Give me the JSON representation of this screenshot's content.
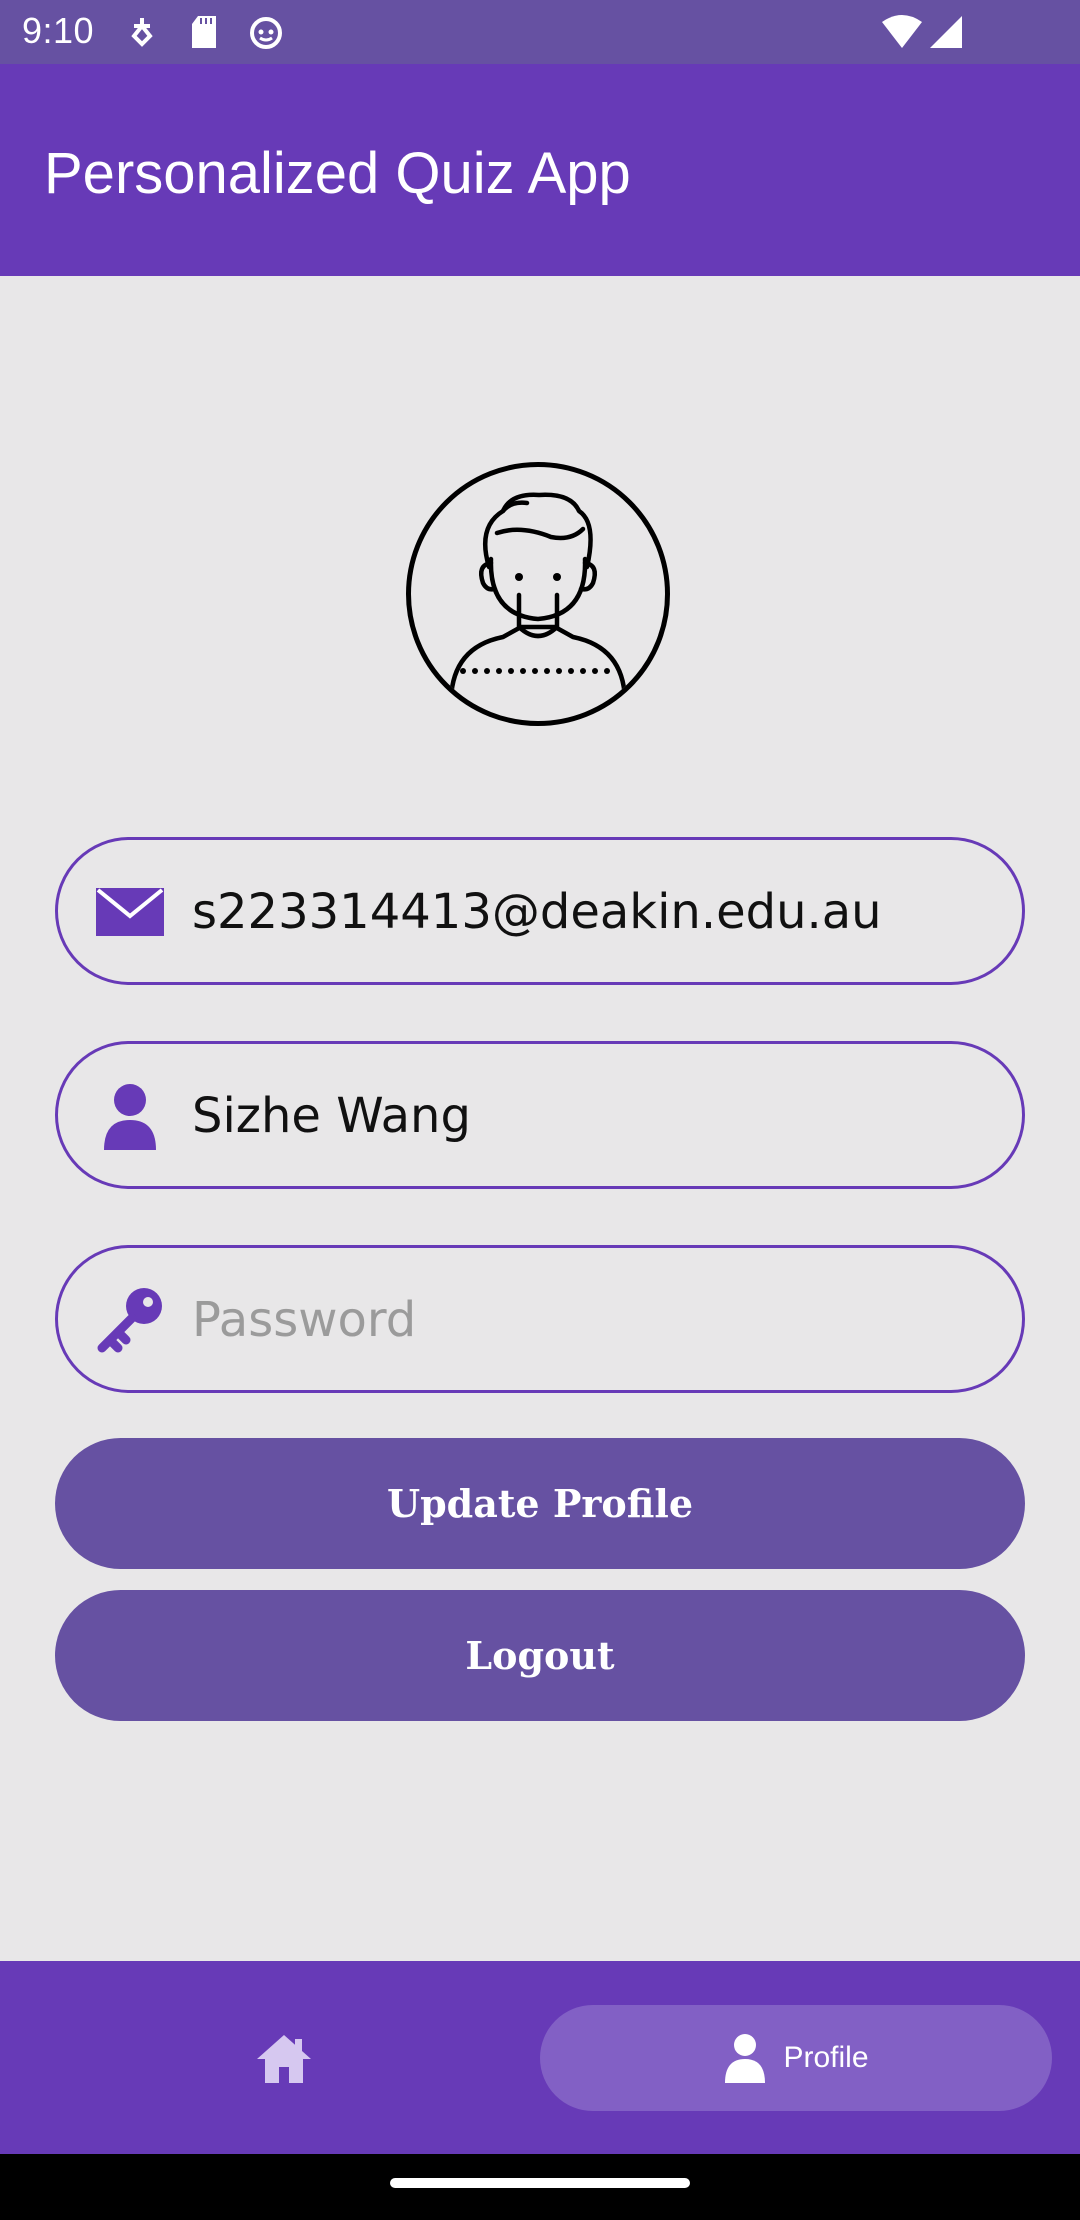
{
  "status_bar": {
    "time": "9:10",
    "icons": [
      "usb-debug-icon",
      "sd-card-icon",
      "android-cat-icon",
      "wifi-icon",
      "signal-icon"
    ]
  },
  "app_bar": {
    "title": "Personalized Quiz App"
  },
  "profile": {
    "avatar_icon": "user-avatar-icon",
    "email": "s223314413@deakin.edu.au",
    "name": "Sizhe Wang",
    "password_placeholder": "Password",
    "password_value": ""
  },
  "buttons": {
    "update_label": "Update Profile",
    "logout_label": "Logout"
  },
  "bottom_nav": {
    "items": [
      {
        "icon": "home-icon",
        "label": "",
        "selected": false
      },
      {
        "icon": "person-icon",
        "label": "Profile",
        "selected": true
      }
    ]
  },
  "colors": {
    "primary": "#673ab7",
    "button": "#6651a2",
    "nav_selected": "#8260c5",
    "background": "#e8e7e8",
    "icon_purple": "#673ab7"
  }
}
